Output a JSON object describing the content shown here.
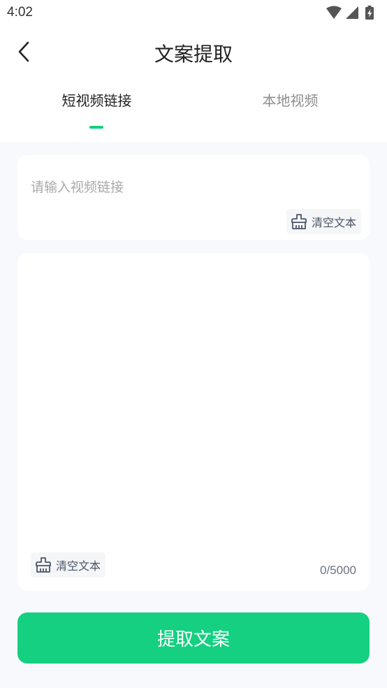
{
  "status_bar": {
    "time": "4:02",
    "icons": [
      "wifi-icon",
      "cellular-signal-icon",
      "battery-charging-icon"
    ]
  },
  "nav": {
    "back_icon": "chevron-left-icon",
    "title": "文案提取"
  },
  "tabs": [
    {
      "label": "短视频链接",
      "active": true
    },
    {
      "label": "本地视频",
      "active": false
    }
  ],
  "link_card": {
    "placeholder": "请输入视频链接",
    "value": "",
    "clear_label": "清空文本",
    "clear_icon": "broom-icon"
  },
  "text_card": {
    "value": "",
    "clear_label": "清空文本",
    "clear_icon": "broom-icon",
    "char_count": "0/5000"
  },
  "submit": {
    "label": "提取文案"
  },
  "colors": {
    "accent": "#14d080",
    "page_bg": "#f7f9fc",
    "card_bg": "#ffffff"
  }
}
